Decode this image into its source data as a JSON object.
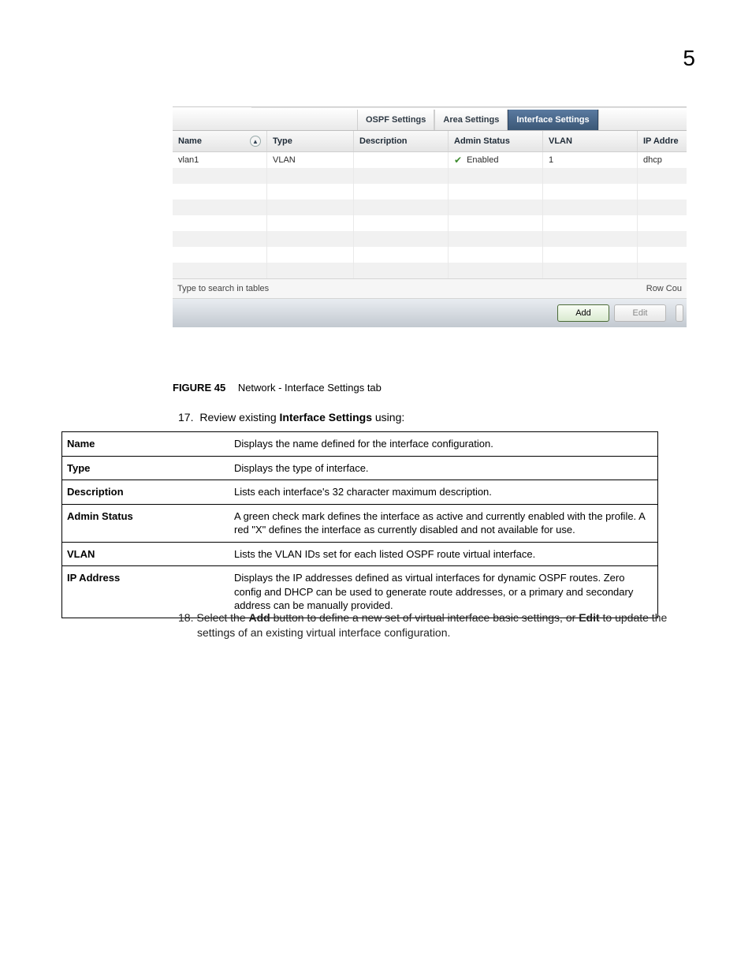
{
  "page_number": "5",
  "tabs": {
    "ospf": "OSPF Settings",
    "area": "Area Settings",
    "interface": "Interface Settings"
  },
  "columns": {
    "name": "Name",
    "type": "Type",
    "description": "Description",
    "admin_status": "Admin Status",
    "vlan": "VLAN",
    "ip": "IP Addre"
  },
  "row1": {
    "name": "vlan1",
    "type": "VLAN",
    "description": "",
    "status": "Enabled",
    "vlan": "1",
    "ip": "dhcp"
  },
  "search_placeholder": "Type to search in tables",
  "row_count_label": "Row Cou",
  "buttons": {
    "add": "Add",
    "edit": "Edit"
  },
  "figure": {
    "label": "FIGURE 45",
    "title": "Network - Interface Settings tab"
  },
  "step17": {
    "num": "17.",
    "prefix": "Review existing ",
    "bold": "Interface Settings",
    "suffix": " using:"
  },
  "defs": [
    {
      "k": "Name",
      "v": "Displays the name defined for the interface configuration."
    },
    {
      "k": "Type",
      "v": "Displays the type of interface."
    },
    {
      "k": "Description",
      "v": "Lists each interface's 32 character maximum description."
    },
    {
      "k": "Admin Status",
      "v": "A green check mark defines the interface as active and currently enabled with the profile. A red \"X\" defines the interface as currently disabled and not available for use."
    },
    {
      "k": "VLAN",
      "v": "Lists the VLAN IDs set for each listed OSPF route virtual interface."
    },
    {
      "k": "IP Address",
      "v": "Displays the IP addresses defined as virtual interfaces for dynamic OSPF routes. Zero config and DHCP can be used to generate route addresses, or a primary and secondary address can be manually provided."
    }
  ],
  "step18": {
    "num": "18.",
    "t1": "Select the ",
    "b1": "Add",
    "t2": " button to define a new set of virtual interface basic settings, or ",
    "b2": "Edit",
    "t3": " to update the settings of an existing virtual interface configuration."
  }
}
